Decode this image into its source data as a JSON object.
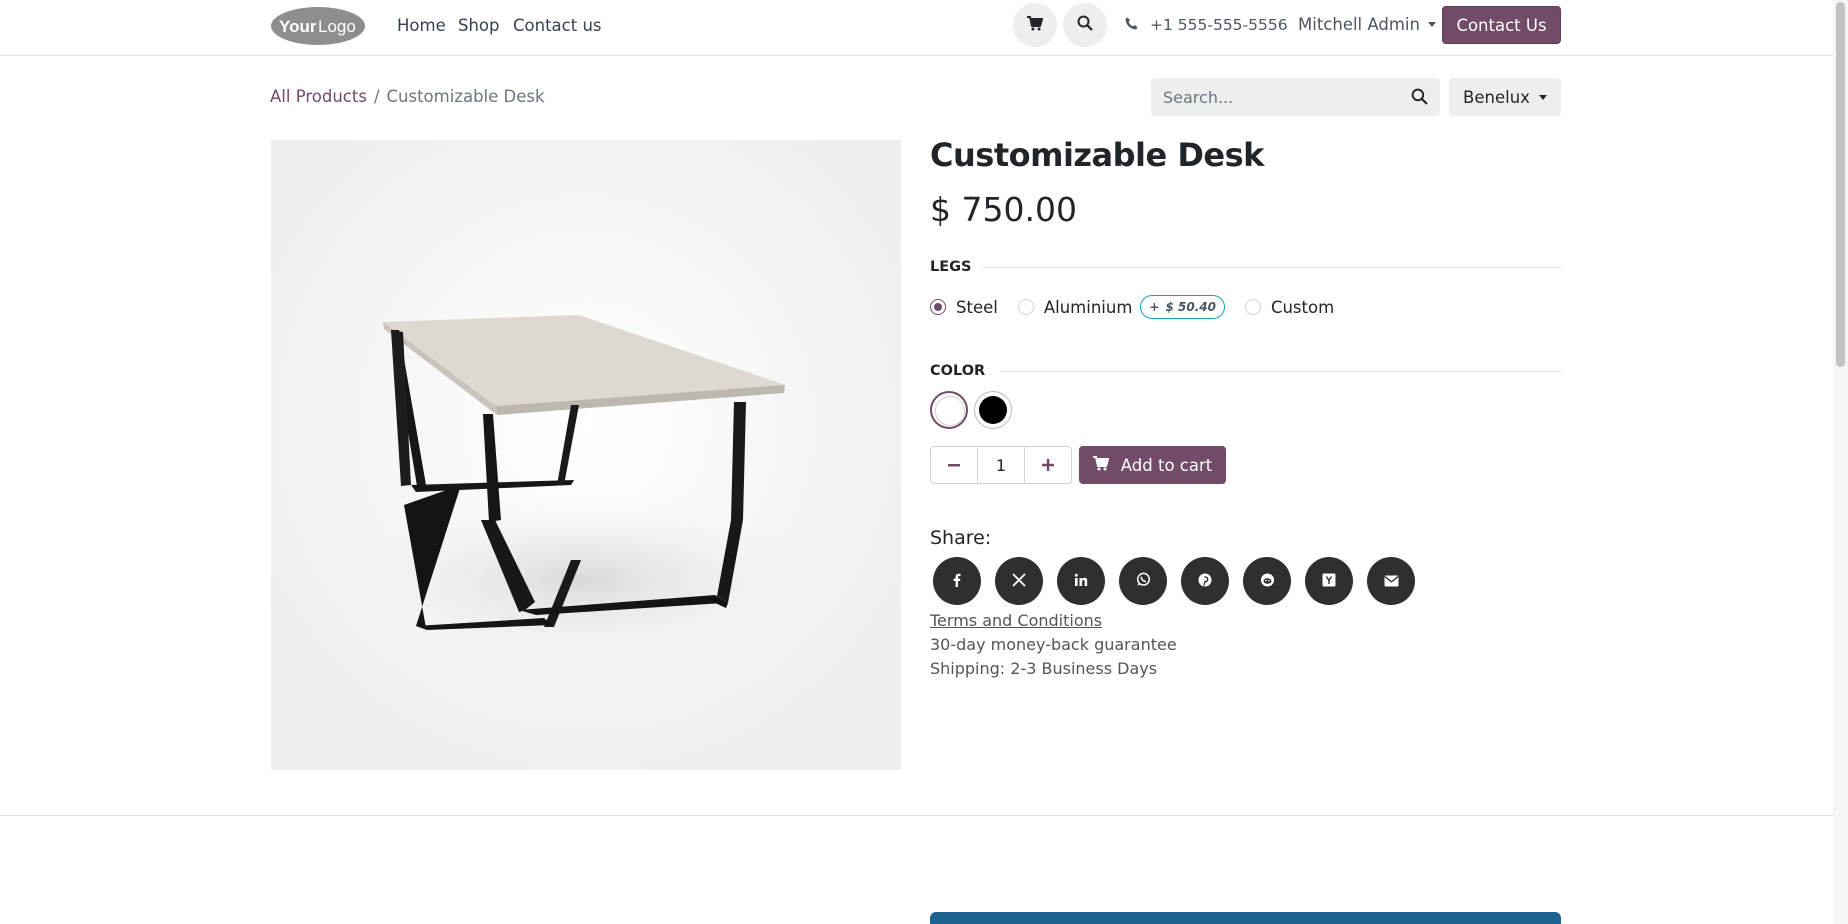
{
  "header": {
    "logo_text": "YourLogo",
    "nav": [
      "Home",
      "Shop",
      "Contact us"
    ],
    "phone": "+1 555-555-5556",
    "user": "Mitchell Admin",
    "contact_button": "Contact Us"
  },
  "breadcrumb": {
    "parent": "All Products",
    "separator": "/",
    "current": "Customizable Desk"
  },
  "search": {
    "placeholder": "Search..."
  },
  "pricelist": "Benelux",
  "product": {
    "name": "Customizable Desk",
    "price": "$ 750.00",
    "legs_label": "LEGS",
    "legs_options": [
      {
        "label": "Steel",
        "selected": true
      },
      {
        "label": "Aluminium",
        "extra": "$ 50.40",
        "extra_sign": "+"
      },
      {
        "label": "Custom"
      }
    ],
    "color_label": "COLOR",
    "colors": [
      "#ffffff",
      "#000000"
    ],
    "selected_color": "#ffffff",
    "quantity": "1",
    "add_to_cart": "Add to cart"
  },
  "share": {
    "label": "Share:",
    "icons": [
      "facebook-icon",
      "x-twitter-icon",
      "linkedin-icon",
      "whatsapp-icon",
      "pinterest-icon",
      "reddit-icon",
      "hacker-news-icon",
      "email-icon"
    ]
  },
  "terms": "Terms and Conditions",
  "guarantee": "30-day money-back guarantee",
  "shipping": "Shipping: 2-3 Business Days",
  "colors": {
    "brand": "#714b67",
    "badge_border": "#17a2b8",
    "share_bg": "#2f2f2f",
    "footer_bar": "#1f6391"
  }
}
